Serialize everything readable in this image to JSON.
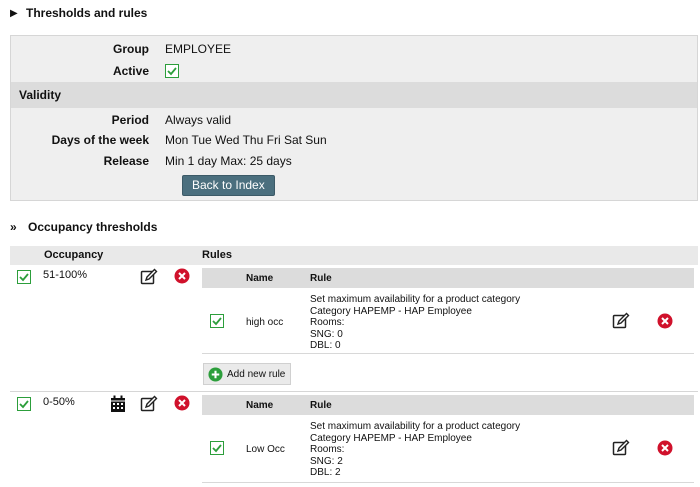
{
  "sections": {
    "thresholds_title": "Thresholds and rules",
    "occupancy_title": "Occupancy thresholds"
  },
  "details": {
    "group_label": "Group",
    "group_value": "EMPLOYEE",
    "active_label": "Active",
    "validity_title": "Validity",
    "period_label": "Period",
    "period_value": "Always valid",
    "days_label": "Days of the week",
    "days_value": "Mon Tue Wed Thu Fri Sat Sun",
    "release_label": "Release",
    "release_value": "Min 1 day Max: 25 days",
    "back_button": "Back to Index"
  },
  "occupancy_table": {
    "col_occupancy": "Occupancy",
    "col_rules": "Rules",
    "rules_col_name": "Name",
    "rules_col_rule": "Rule",
    "add_rule_label": "Add new rule",
    "thresholds": [
      {
        "range": "51-100%",
        "rules": [
          {
            "name": "high occ",
            "lines": [
              "Set maximum availability for a product category",
              "Category HAPEMP - HAP Employee",
              "Rooms:",
              "SNG: 0",
              "DBL: 0"
            ]
          }
        ]
      },
      {
        "range": "0-50%",
        "rules": [
          {
            "name": "Low Occ",
            "lines": [
              "Set maximum availability for a product category",
              "Category HAPEMP - HAP Employee",
              "Rooms:",
              "SNG: 2",
              "DBL: 2"
            ]
          }
        ]
      }
    ]
  },
  "colors": {
    "check_green": "#2c9e3b",
    "delete_red": "#d0112b",
    "button_bg": "#4b6f7e",
    "add_green": "#2c9e3b"
  }
}
